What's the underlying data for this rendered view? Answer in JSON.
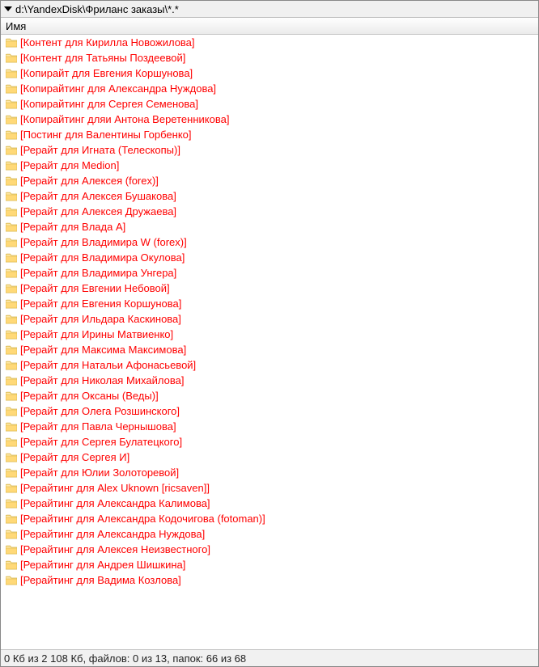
{
  "path": "d:\\YandexDisk\\Фриланс заказы\\*.*",
  "column_header": "Имя",
  "items": [
    "[Контент для Кирилла Новожилова]",
    "[Контент для Татьяны Поздеевой]",
    "[Копирайт для Евгения Коршунова]",
    "[Копирайтинг для Александра Нуждова]",
    "[Копирайтинг для Сергея Семенова]",
    "[Копирайтинг дляи Антона Веретенникова]",
    "[Постинг для Валентины Горбенко]",
    "[Рерайт  для Игната (Телескопы)]",
    "[Рерайт для Medion]",
    "[Рерайт для Алексея (forex)]",
    "[Рерайт для Алексея Бушакова]",
    "[Рерайт для Алексея Дружаева]",
    "[Рерайт для Влада А]",
    "[Рерайт для Владимира W (forex)]",
    "[Рерайт для Владимира Окулова]",
    "[Рерайт для Владимира Унгера]",
    "[Рерайт для Евгении Небовой]",
    "[Рерайт для Евгения Коршунова]",
    "[Рерайт для Ильдара Каскинова]",
    "[Рерайт для Ирины Матвиенко]",
    "[Рерайт для Максима Максимова]",
    "[Рерайт для Натальи Афонасьевой]",
    "[Рерайт для Николая Михайлова]",
    "[Рерайт для Оксаны (Веды)]",
    "[Рерайт для Олега Розшинского]",
    "[Рерайт для Павла Чернышова]",
    "[Рерайт для Сергея Булатецкого]",
    "[Рерайт для Сергея И]",
    "[Рерайт для Юлии Золоторевой]",
    "[Рерайтинг для Alex Uknown [ricsaven]]",
    "[Рерайтинг для Александра Калимова]",
    "[Рерайтинг для Александра Кодочигова (fotoman)]",
    "[Рерайтинг для Александра Нуждова]",
    "[Рерайтинг для Алексея Неизвестного]",
    "[Рерайтинг для Андрея Шишкина]",
    "[Рерайтинг для Вадима Козлова]"
  ],
  "status": "0 Кб из 2 108 Кб, файлов: 0 из 13, папок: 66 из 68"
}
